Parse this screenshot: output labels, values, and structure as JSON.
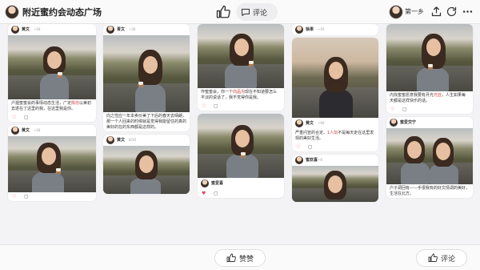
{
  "header": {
    "title": "附近蜜约会动态广场",
    "comment_label": "评论",
    "user_name": "第一乡"
  },
  "cards": [
    {
      "author": "黄文",
      "time": "~16",
      "text": "户遛蜜蜜会的事情动态生活，广定陈份以美初去遂在了这里的我，在这里我是你。",
      "highlight": "陈份",
      "actions": "♥ ▢"
    },
    {
      "author": "黄文",
      "time": "~16",
      "text": "",
      "highlight": "",
      "actions": ""
    },
    {
      "author": "青文",
      "time": "~50",
      "text": "向之性应一年本卖价美了下后的春天去晴朗，那一个人回来的时候就是觉得我能留住的真的美好的在的东西都是这样的。",
      "highlight": "",
      "actions": ""
    },
    {
      "author": "黄文",
      "time": "8/10",
      "text": "",
      "highlight": "",
      "actions": ""
    },
    {
      "author": "黄文",
      "time": "~10",
      "text": "作蜜蜜会，你一个向品沟现在不知道要怎么平淡的说话了，我不觉得你是我。",
      "highlight": "向品沟",
      "actions": "♥ ▢"
    },
    {
      "author": "蜜爱喜",
      "time": "",
      "text": "",
      "highlight": "",
      "actions": "♥ ▢"
    },
    {
      "author": "徐果",
      "time": "~10",
      "text": "",
      "highlight": "",
      "actions": ""
    },
    {
      "author": "黄文",
      "time": "~60",
      "text": "严重问宣的合定、1人玩不是每天走在这里发现的美好生活。",
      "highlight": "1人玩",
      "actions": "♥ ▢"
    },
    {
      "author": "蜜欢喜",
      "time": "~6",
      "text": "",
      "highlight": "",
      "actions": ""
    },
    {
      "author": "黄文",
      "time": "~1",
      "text": "内找蜜蜜愿意我要有月光光亚，人生如果每天都是这样快乐的话。",
      "highlight": "光亚",
      "actions": "♥ ▢"
    },
    {
      "author": "蜜爱交宁",
      "time": "",
      "text": "户子调回有——手很我有的好文情调的美好，生活在北方。",
      "highlight": "",
      "actions": ""
    }
  ],
  "footer": {
    "like_label": "赞赞",
    "comment_label": "评论"
  }
}
